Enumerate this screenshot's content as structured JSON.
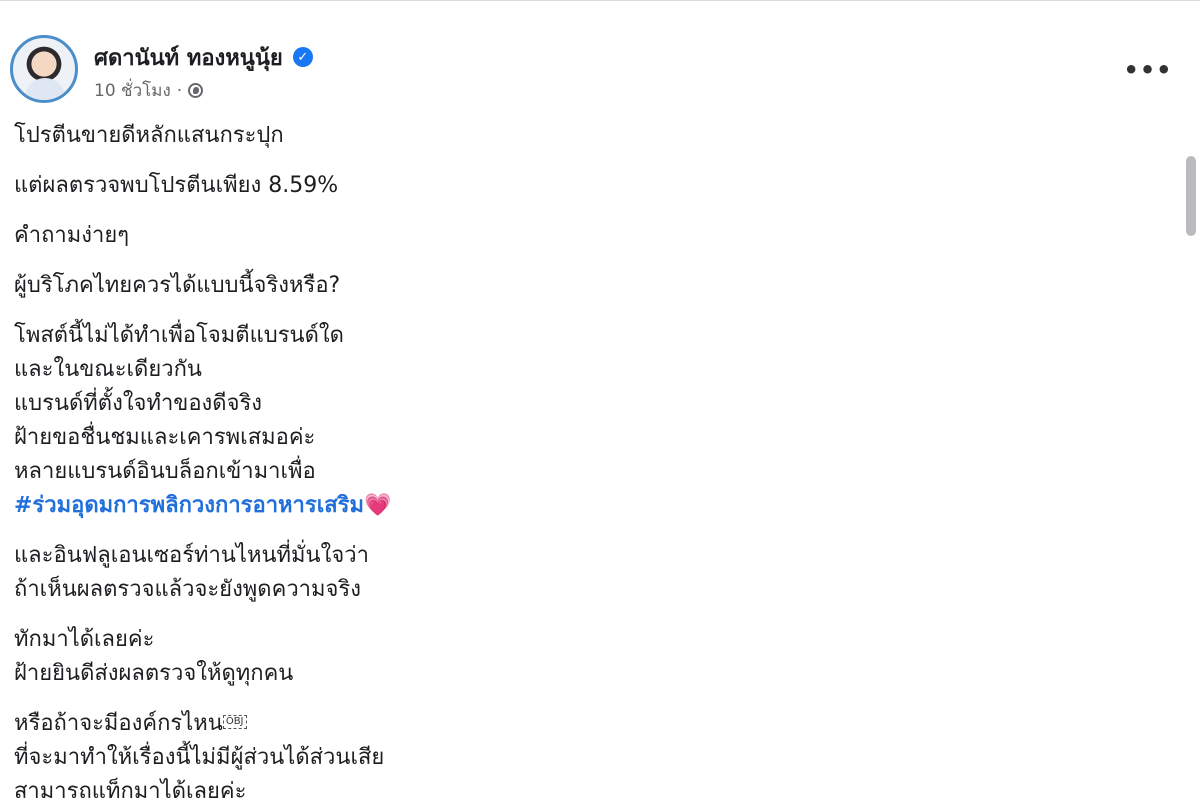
{
  "post": {
    "author": "ศดานันท์ ทองหนูนุ้ย",
    "verified": true,
    "time": "10 ชั่วโมง",
    "separator": "·",
    "privacy_icon": "globe-icon",
    "more_label": "•••",
    "paragraphs": [
      [
        "โปรตีนขายดีหลักแสนกระปุก"
      ],
      [
        "แต่ผลตรวจพบโปรตีนเพียง 8.59%"
      ],
      [
        "คำถามง่ายๆ"
      ],
      [
        "ผู้บริโภคไทยควรได้แบบนี้จริงหรือ?"
      ],
      [
        "โพสต์นี้ไม่ได้ทำเพื่อโจมตีแบรนด์ใด",
        "และในขณะเดียวกัน",
        "แบรนด์ที่ตั้งใจทำของดีจริง",
        "ฝ้ายขอชื่นชมและเคารพเสมอค่ะ",
        "หลายแบรนด์อินบล็อกเข้ามาเพื่อ"
      ],
      [
        "และอินฟลูเอนเซอร์ท่านไหนที่มั่นใจว่า",
        "ถ้าเห็นผลตรวจแล้วจะยังพูดความจริง"
      ],
      [
        "ทักมาได้เลยค่ะ",
        "ฝ้ายยินดีส่งผลตรวจให้ดูทุกคน"
      ],
      [
        "หรือถ้าจะมีองค์กรไหน",
        "ที่จะมาทำให้เรื่องนี้ไม่มีผู้ส่วนได้ส่วนเสีย",
        "สามารถแท็กมาได้เลยค่ะ"
      ]
    ],
    "hashtag": "#ร่วมอุดมการพลิกวงการอาหารเสริม",
    "heart": "💗",
    "obj_glyph": "OBJ"
  },
  "colors": {
    "link": "#216fdb",
    "meta": "#65676b",
    "verified": "#1877f2",
    "heart": "#ff6fb3"
  }
}
